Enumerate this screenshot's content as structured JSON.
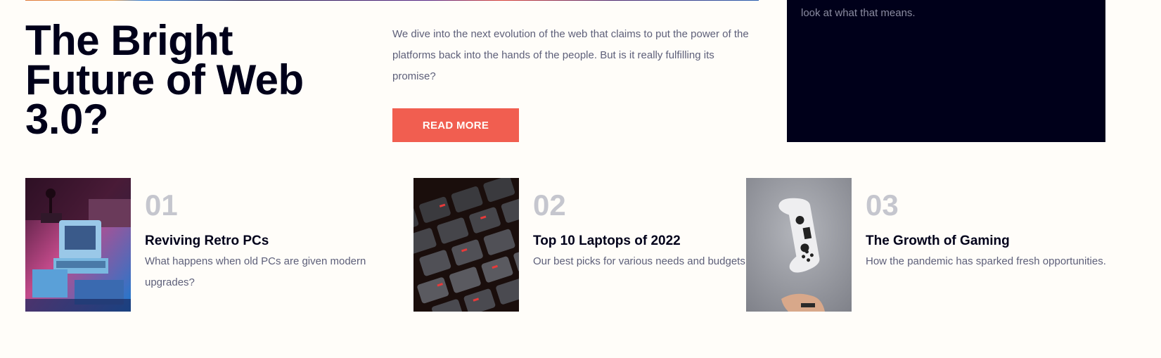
{
  "hero": {
    "title": "The Bright Future of Web 3.0?",
    "description": "We dive into the next evolution of the web that claims to put the power of the platforms back into the hands of the people. But is it really fulfilling its promise?",
    "read_more_label": "READ MORE"
  },
  "new_panel": {
    "text": "look at what that means."
  },
  "articles": [
    {
      "number": "01",
      "title": "Reviving Retro PCs",
      "description": "What happens when old PCs are given modern upgrades?",
      "image": "retro-pc-image"
    },
    {
      "number": "02",
      "title": "Top 10 Laptops of 2022",
      "description": "Our best picks for various needs and budgets.",
      "image": "laptop-keyboard-image"
    },
    {
      "number": "03",
      "title": "The Growth of Gaming",
      "description": "How the pandemic has sparked fresh opportunities.",
      "image": "game-controller-image"
    }
  ],
  "colors": {
    "background": "#fffdf9",
    "accent": "#f15e50",
    "dark": "#00001a",
    "muted_text": "#5d5f79",
    "number_grey": "#c5c6ce"
  }
}
